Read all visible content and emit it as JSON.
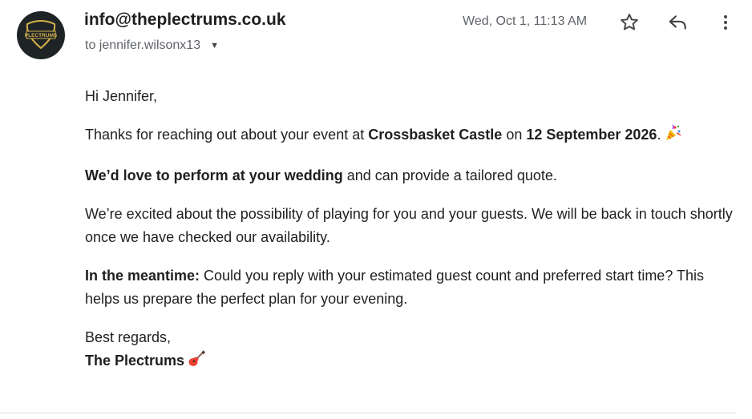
{
  "header": {
    "avatar_icon": "the-plectrums-logo",
    "logo_text": "PLECTRUMS",
    "sender_email": "info@theplectrums.co.uk",
    "recipient_label": "to jennifer.wilsonx13",
    "date": "Wed, Oct 1, 11:13 AM",
    "actions": {
      "star_icon": "star-icon",
      "reply_icon": "reply-icon",
      "more_icon": "more-vert-icon"
    }
  },
  "message": {
    "greeting": "Hi Jennifer,",
    "p1": {
      "text1": "Thanks for reaching out about your event at ",
      "venue": "Crossbasket Castle",
      "text2": " on ",
      "date": "12 September 2026",
      "text3": ".",
      "emoji": "party-popper-icon"
    },
    "p2": {
      "bold": "We’d love to perform at your wedding",
      "rest": " and can provide a tailored quote."
    },
    "p3": "We’re excited about the possibility of playing for you and your guests. We will be back in touch shortly once we have checked our availability.",
    "p4": {
      "bold": "In the meantime:",
      "rest": " Could you reply with your estimated guest count and preferred start time? This helps us prepare the perfect plan for your evening."
    },
    "closing": "Best regards,",
    "signature": "The Plectrums",
    "signature_emoji": "guitar-icon"
  }
}
